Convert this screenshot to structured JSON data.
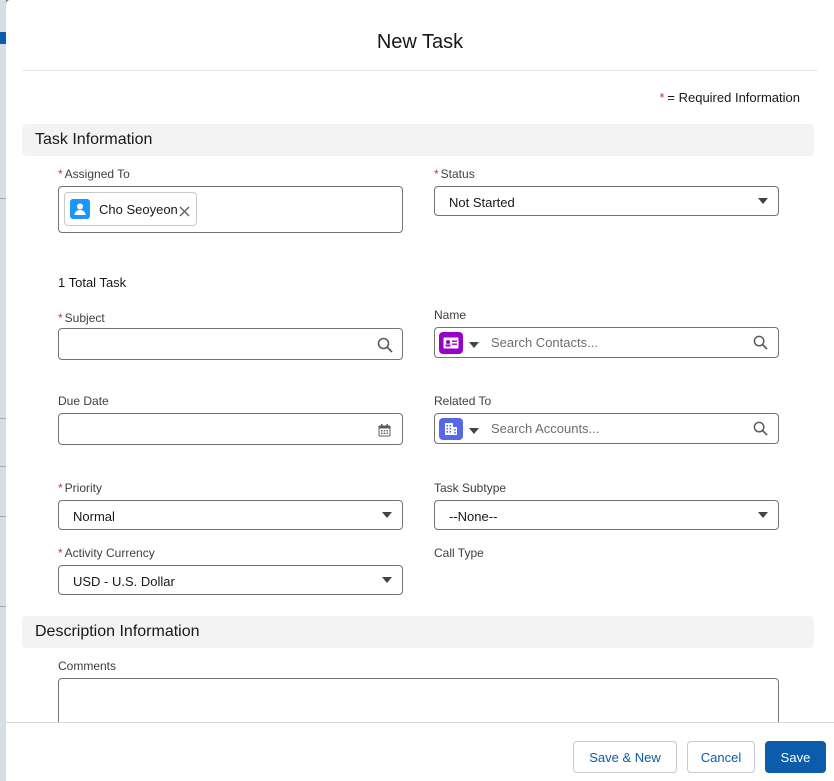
{
  "modal": {
    "title": "New Task"
  },
  "required_info": {
    "star": "*",
    "text": "= Required Information"
  },
  "sections": {
    "task": "Task Information",
    "description": "Description Information"
  },
  "fields": {
    "assigned_to": {
      "label": "Assigned To",
      "required": "*",
      "pill": "Cho Seoyeon"
    },
    "status": {
      "label": "Status",
      "required": "*",
      "value": "Not Started"
    },
    "total_tasks": "1 Total Task",
    "subject": {
      "label": "Subject",
      "required": "*",
      "value": ""
    },
    "name": {
      "label": "Name",
      "placeholder": "Search Contacts..."
    },
    "due_date": {
      "label": "Due Date",
      "value": ""
    },
    "related_to": {
      "label": "Related To",
      "placeholder": "Search Accounts..."
    },
    "priority": {
      "label": "Priority",
      "required": "*",
      "value": "Normal"
    },
    "task_subtype": {
      "label": "Task Subtype",
      "value": "--None--"
    },
    "activity_currency": {
      "label": "Activity Currency",
      "required": "*",
      "value": "USD - U.S. Dollar"
    },
    "call_type": {
      "label": "Call Type"
    },
    "comments": {
      "label": "Comments"
    }
  },
  "footer": {
    "save_new": "Save & New",
    "cancel": "Cancel",
    "save": "Save"
  },
  "colors": {
    "brand": "#0b5cab",
    "required": "#c23934",
    "contact_icon": "#9602c7",
    "account_icon": "#5867e8",
    "user_icon": "#1b96ff"
  },
  "icons": {
    "user": "user-icon",
    "contact": "contact-icon",
    "account": "account-icon",
    "search": "search-icon",
    "calendar": "calendar-icon",
    "close": "close-icon"
  }
}
